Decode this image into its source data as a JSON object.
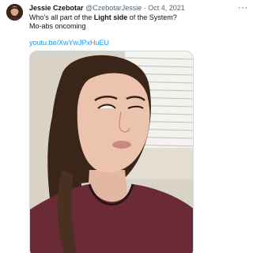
{
  "tweet": {
    "author_name": "Jessie Czebotar",
    "author_handle": "@CzebotarJessie",
    "separator": "·",
    "date": "Oct 4, 2021",
    "text_part1": "Who's all part of the ",
    "text_bold": "Light side",
    "text_part2": " of the System?",
    "text_line2": "Mo-abs oncoming",
    "link": "youtu.be/XwYwJPxHuEU",
    "more_label": "···"
  },
  "colors": {
    "link": "#1d9bf0",
    "secondary_text": "#536471",
    "primary_text": "#0f1419"
  },
  "icons": {
    "more": "more-horizontal-icon",
    "avatar": "profile-avatar"
  }
}
